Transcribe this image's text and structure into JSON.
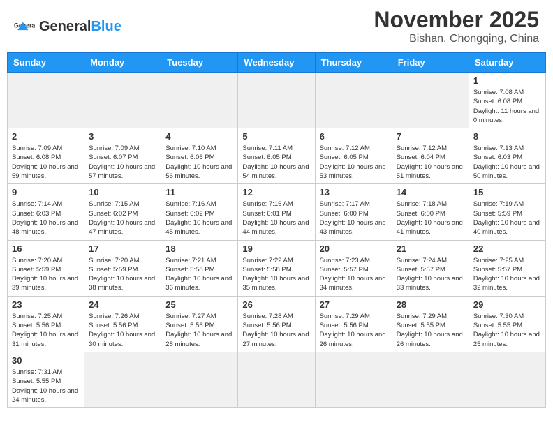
{
  "header": {
    "logo_general": "General",
    "logo_blue": "Blue",
    "title": "November 2025",
    "subtitle": "Bishan, Chongqing, China"
  },
  "weekdays": [
    "Sunday",
    "Monday",
    "Tuesday",
    "Wednesday",
    "Thursday",
    "Friday",
    "Saturday"
  ],
  "weeks": [
    [
      {
        "day": "",
        "info": "",
        "empty": true
      },
      {
        "day": "",
        "info": "",
        "empty": true
      },
      {
        "day": "",
        "info": "",
        "empty": true
      },
      {
        "day": "",
        "info": "",
        "empty": true
      },
      {
        "day": "",
        "info": "",
        "empty": true
      },
      {
        "day": "",
        "info": "",
        "empty": true
      },
      {
        "day": "1",
        "info": "Sunrise: 7:08 AM\nSunset: 6:08 PM\nDaylight: 11 hours and 0 minutes."
      }
    ],
    [
      {
        "day": "2",
        "info": "Sunrise: 7:09 AM\nSunset: 6:08 PM\nDaylight: 10 hours and 59 minutes."
      },
      {
        "day": "3",
        "info": "Sunrise: 7:09 AM\nSunset: 6:07 PM\nDaylight: 10 hours and 57 minutes."
      },
      {
        "day": "4",
        "info": "Sunrise: 7:10 AM\nSunset: 6:06 PM\nDaylight: 10 hours and 56 minutes."
      },
      {
        "day": "5",
        "info": "Sunrise: 7:11 AM\nSunset: 6:05 PM\nDaylight: 10 hours and 54 minutes."
      },
      {
        "day": "6",
        "info": "Sunrise: 7:12 AM\nSunset: 6:05 PM\nDaylight: 10 hours and 53 minutes."
      },
      {
        "day": "7",
        "info": "Sunrise: 7:12 AM\nSunset: 6:04 PM\nDaylight: 10 hours and 51 minutes."
      },
      {
        "day": "8",
        "info": "Sunrise: 7:13 AM\nSunset: 6:03 PM\nDaylight: 10 hours and 50 minutes."
      }
    ],
    [
      {
        "day": "9",
        "info": "Sunrise: 7:14 AM\nSunset: 6:03 PM\nDaylight: 10 hours and 48 minutes."
      },
      {
        "day": "10",
        "info": "Sunrise: 7:15 AM\nSunset: 6:02 PM\nDaylight: 10 hours and 47 minutes."
      },
      {
        "day": "11",
        "info": "Sunrise: 7:16 AM\nSunset: 6:02 PM\nDaylight: 10 hours and 45 minutes."
      },
      {
        "day": "12",
        "info": "Sunrise: 7:16 AM\nSunset: 6:01 PM\nDaylight: 10 hours and 44 minutes."
      },
      {
        "day": "13",
        "info": "Sunrise: 7:17 AM\nSunset: 6:00 PM\nDaylight: 10 hours and 43 minutes."
      },
      {
        "day": "14",
        "info": "Sunrise: 7:18 AM\nSunset: 6:00 PM\nDaylight: 10 hours and 41 minutes."
      },
      {
        "day": "15",
        "info": "Sunrise: 7:19 AM\nSunset: 5:59 PM\nDaylight: 10 hours and 40 minutes."
      }
    ],
    [
      {
        "day": "16",
        "info": "Sunrise: 7:20 AM\nSunset: 5:59 PM\nDaylight: 10 hours and 39 minutes."
      },
      {
        "day": "17",
        "info": "Sunrise: 7:20 AM\nSunset: 5:59 PM\nDaylight: 10 hours and 38 minutes."
      },
      {
        "day": "18",
        "info": "Sunrise: 7:21 AM\nSunset: 5:58 PM\nDaylight: 10 hours and 36 minutes."
      },
      {
        "day": "19",
        "info": "Sunrise: 7:22 AM\nSunset: 5:58 PM\nDaylight: 10 hours and 35 minutes."
      },
      {
        "day": "20",
        "info": "Sunrise: 7:23 AM\nSunset: 5:57 PM\nDaylight: 10 hours and 34 minutes."
      },
      {
        "day": "21",
        "info": "Sunrise: 7:24 AM\nSunset: 5:57 PM\nDaylight: 10 hours and 33 minutes."
      },
      {
        "day": "22",
        "info": "Sunrise: 7:25 AM\nSunset: 5:57 PM\nDaylight: 10 hours and 32 minutes."
      }
    ],
    [
      {
        "day": "23",
        "info": "Sunrise: 7:25 AM\nSunset: 5:56 PM\nDaylight: 10 hours and 31 minutes."
      },
      {
        "day": "24",
        "info": "Sunrise: 7:26 AM\nSunset: 5:56 PM\nDaylight: 10 hours and 30 minutes."
      },
      {
        "day": "25",
        "info": "Sunrise: 7:27 AM\nSunset: 5:56 PM\nDaylight: 10 hours and 28 minutes."
      },
      {
        "day": "26",
        "info": "Sunrise: 7:28 AM\nSunset: 5:56 PM\nDaylight: 10 hours and 27 minutes."
      },
      {
        "day": "27",
        "info": "Sunrise: 7:29 AM\nSunset: 5:56 PM\nDaylight: 10 hours and 26 minutes."
      },
      {
        "day": "28",
        "info": "Sunrise: 7:29 AM\nSunset: 5:55 PM\nDaylight: 10 hours and 26 minutes."
      },
      {
        "day": "29",
        "info": "Sunrise: 7:30 AM\nSunset: 5:55 PM\nDaylight: 10 hours and 25 minutes."
      }
    ],
    [
      {
        "day": "30",
        "info": "Sunrise: 7:31 AM\nSunset: 5:55 PM\nDaylight: 10 hours and 24 minutes."
      },
      {
        "day": "",
        "info": "",
        "empty": true
      },
      {
        "day": "",
        "info": "",
        "empty": true
      },
      {
        "day": "",
        "info": "",
        "empty": true
      },
      {
        "day": "",
        "info": "",
        "empty": true
      },
      {
        "day": "",
        "info": "",
        "empty": true
      },
      {
        "day": "",
        "info": "",
        "empty": true
      }
    ]
  ]
}
